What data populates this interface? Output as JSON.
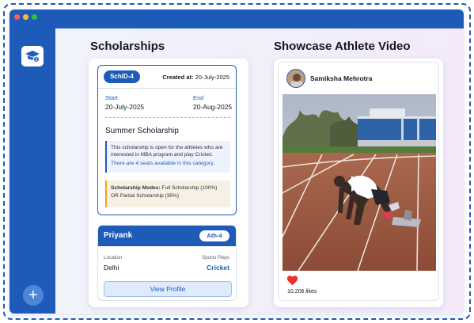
{
  "window": {
    "controls": [
      "close",
      "minimize",
      "maximize"
    ]
  },
  "sidebar": {
    "logo_icon": "scholarship-cap-icon",
    "add_icon": "plus-icon",
    "add_label": "+"
  },
  "scholarships": {
    "heading": "Scholarships",
    "card": {
      "id": "SchID-4",
      "created_label": "Created at:",
      "created_value": "20-July-2025",
      "start_label": "Start",
      "start_value": "20-July-2025",
      "end_label": "End",
      "end_value": "20-Aug-2025",
      "name": "Summer Scholarship",
      "description": "This scholarship is open for the athletes who are interested in MBA program and play Cricket.",
      "seats": "There are 4 seats available in this category.",
      "modes_label": "Scholarship Modes:",
      "modes_value": "Full Scholarship (100%) OR Partial Scholarship (35%)"
    },
    "athlete": {
      "name": "Priyank",
      "tag": "Ath-4",
      "location_label": "Location",
      "location_value": "Delhi",
      "sports_label": "Sports Plays",
      "sports_value": "Cricket",
      "button": "View Profile"
    }
  },
  "showcase": {
    "heading": "Showcase Athlete Video",
    "user": "Samiksha Mehrotra",
    "likes": "10,206 likes",
    "play_icon": "play-icon",
    "like_icon": "heart-icon"
  },
  "colors": {
    "primary": "#1e5bb8",
    "accent_orange": "#f2a516",
    "like_red": "#e8332a"
  }
}
